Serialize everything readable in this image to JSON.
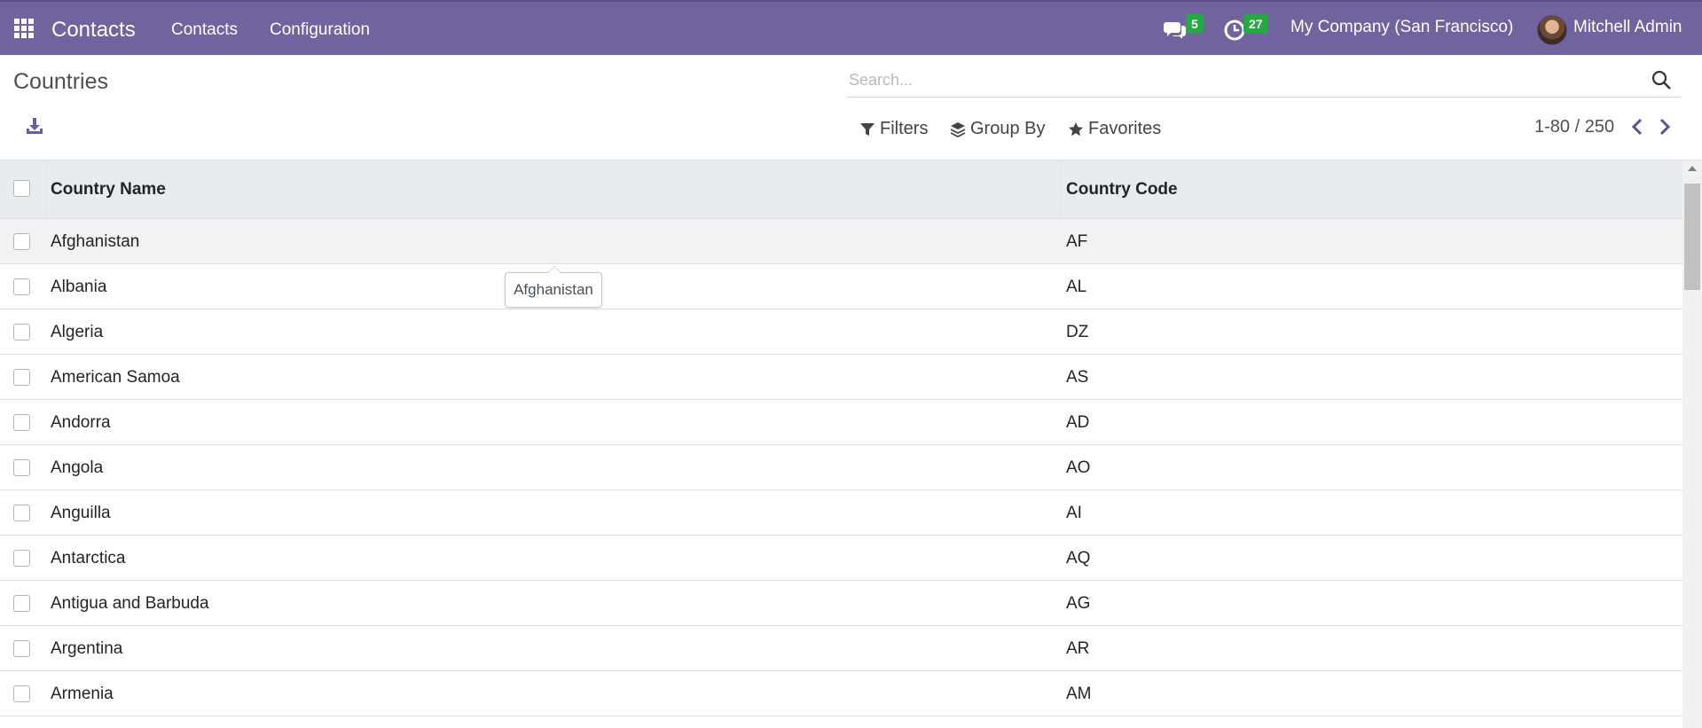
{
  "navbar": {
    "app_title": "Contacts",
    "menus": [
      "Contacts",
      "Configuration"
    ],
    "messages_count": "5",
    "activities_count": "27",
    "company": "My Company (San Francisco)",
    "user": "Mitchell Admin",
    "bg_color": "#71639e",
    "badge_color": "#28a745"
  },
  "control_panel": {
    "breadcrumb": "Countries",
    "search_placeholder": "Search...",
    "filters_label": "Filters",
    "group_by_label": "Group By",
    "favorites_label": "Favorites",
    "pager": "1-80 / 250"
  },
  "table": {
    "columns": [
      "Country Name",
      "Country Code"
    ],
    "rows": [
      {
        "name": "Afghanistan",
        "code": "AF"
      },
      {
        "name": "Albania",
        "code": "AL"
      },
      {
        "name": "Algeria",
        "code": "DZ"
      },
      {
        "name": "American Samoa",
        "code": "AS"
      },
      {
        "name": "Andorra",
        "code": "AD"
      },
      {
        "name": "Angola",
        "code": "AO"
      },
      {
        "name": "Anguilla",
        "code": "AI"
      },
      {
        "name": "Antarctica",
        "code": "AQ"
      },
      {
        "name": "Antigua and Barbuda",
        "code": "AG"
      },
      {
        "name": "Argentina",
        "code": "AR"
      },
      {
        "name": "Armenia",
        "code": "AM"
      }
    ]
  },
  "tooltip": {
    "text": "Afghanistan"
  }
}
